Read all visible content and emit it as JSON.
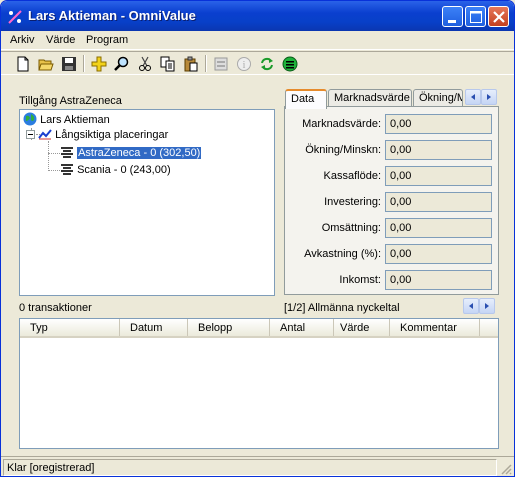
{
  "window": {
    "title": "Lars Aktieman - OmniValue",
    "brand_color": "#0a3fcf"
  },
  "menu": {
    "items": [
      {
        "label": "Arkiv"
      },
      {
        "label": "Värde"
      },
      {
        "label": "Program"
      }
    ]
  },
  "toolbar": {
    "icons": [
      "new-file-icon",
      "open-folder-icon",
      "save-icon",
      "add-icon",
      "search-icon",
      "cut-icon",
      "copy-icon",
      "paste-icon",
      "properties-icon",
      "info-icon",
      "refresh-icon",
      "calculator-icon"
    ]
  },
  "tree_panel": {
    "heading": "Tillgång AstraZeneca",
    "root": "Lars Aktieman",
    "group": "Långsiktiga placeringar",
    "items": [
      {
        "label": "AstraZeneca - 0 (302,50)",
        "selected": true
      },
      {
        "label": "Scania - 0 (243,00)",
        "selected": false
      }
    ]
  },
  "tabs": {
    "items": [
      {
        "label": "Data",
        "active": true
      },
      {
        "label": "Marknadsvärde",
        "active": false
      },
      {
        "label": "Ökning/M",
        "active": false
      }
    ],
    "active_tab_accent": "#e68b2c"
  },
  "key_figures": {
    "fields": [
      {
        "label": "Marknadsvärde:",
        "value": "0,00"
      },
      {
        "label": "Ökning/Minskn:",
        "value": "0,00"
      },
      {
        "label": "Kassaflöde:",
        "value": "0,00"
      },
      {
        "label": "Investering:",
        "value": "0,00"
      },
      {
        "label": "Omsättning:",
        "value": "0,00"
      },
      {
        "label": "Avkastning (%):",
        "value": "0,00"
      },
      {
        "label": "Inkomst:",
        "value": "0,00"
      }
    ],
    "page_label": "[1/2] Allmänna nyckeltal"
  },
  "transactions": {
    "count_label": "0 transaktioner",
    "columns": [
      "Typ",
      "Datum",
      "Belopp",
      "Antal",
      "Värde",
      "Kommentar"
    ],
    "rows": []
  },
  "status": {
    "text": "Klar [oregistrerad]"
  },
  "selection_color": "#316ac5"
}
